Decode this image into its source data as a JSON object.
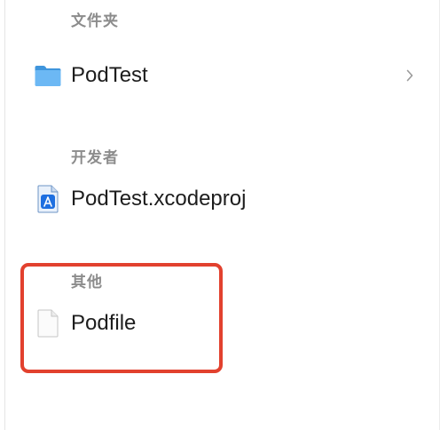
{
  "sections": [
    {
      "header": "文件夹",
      "items": [
        {
          "label": "PodTest",
          "icon": "folder-icon",
          "has_chevron": true
        }
      ]
    },
    {
      "header": "开发者",
      "items": [
        {
          "label": "PodTest.xcodeproj",
          "icon": "xcode-project-icon",
          "has_chevron": false
        }
      ]
    },
    {
      "header": "其他",
      "items": [
        {
          "label": "Podfile",
          "icon": "document-icon",
          "has_chevron": false
        }
      ]
    }
  ],
  "colors": {
    "section_header": "#8c8c8c",
    "item_text": "#1d1d1d",
    "highlight_border": "#e2412e",
    "folder_blue": "#5aaef0"
  }
}
